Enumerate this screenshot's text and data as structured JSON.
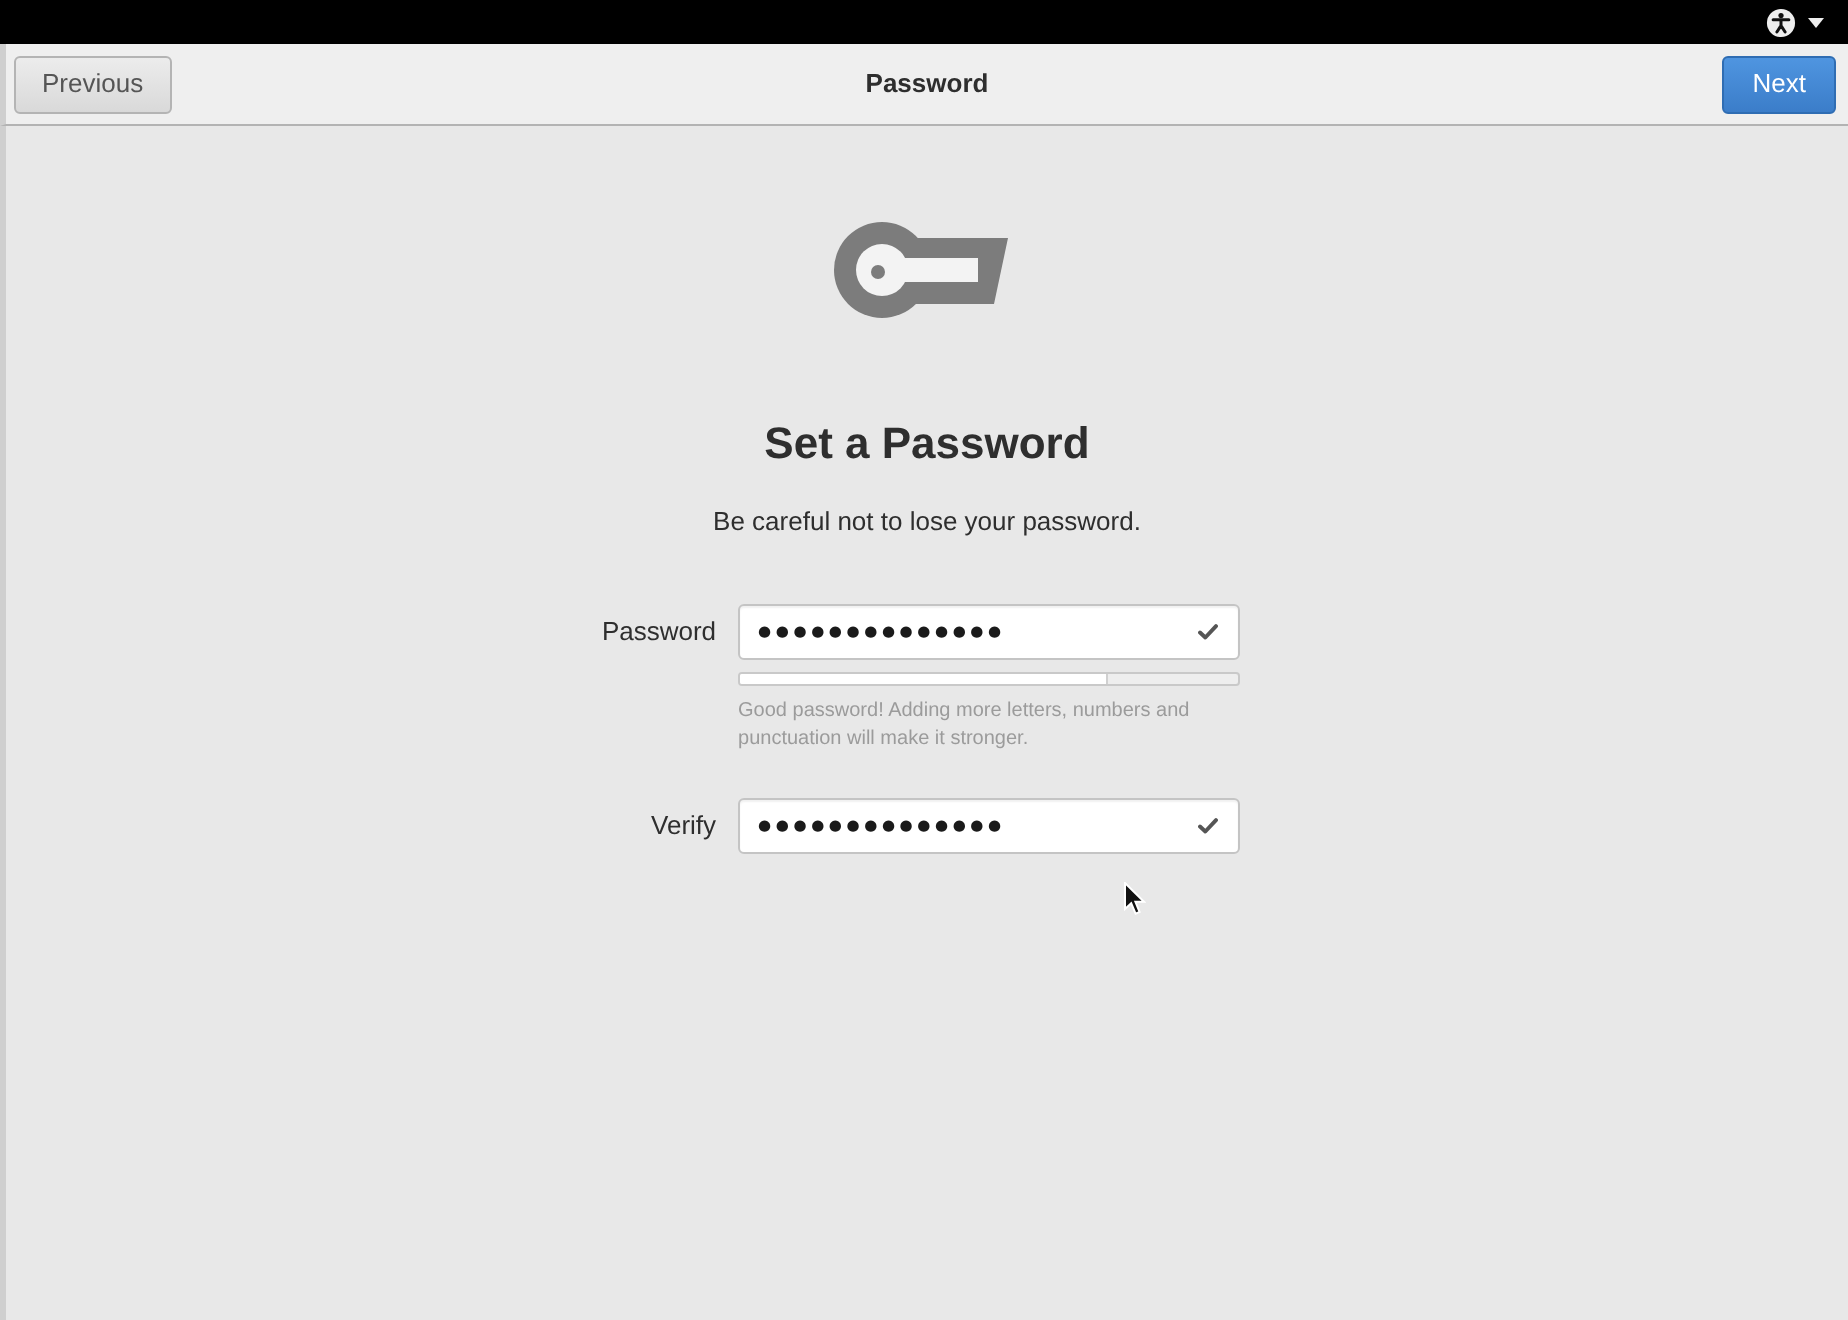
{
  "header": {
    "previous_button": "Previous",
    "title": "Password",
    "next_button": "Next"
  },
  "page": {
    "heading": "Set a Password",
    "subtitle": "Be careful not to lose your password."
  },
  "password_field": {
    "label": "Password",
    "value": "●●●●●●●●●●●●●●",
    "valid": true
  },
  "strength_meter": {
    "level": 0.74,
    "hint": "Good password! Adding more letters, numbers and punctuation will make it stronger."
  },
  "verify_field": {
    "label": "Verify",
    "value": "●●●●●●●●●●●●●●",
    "valid": true
  }
}
